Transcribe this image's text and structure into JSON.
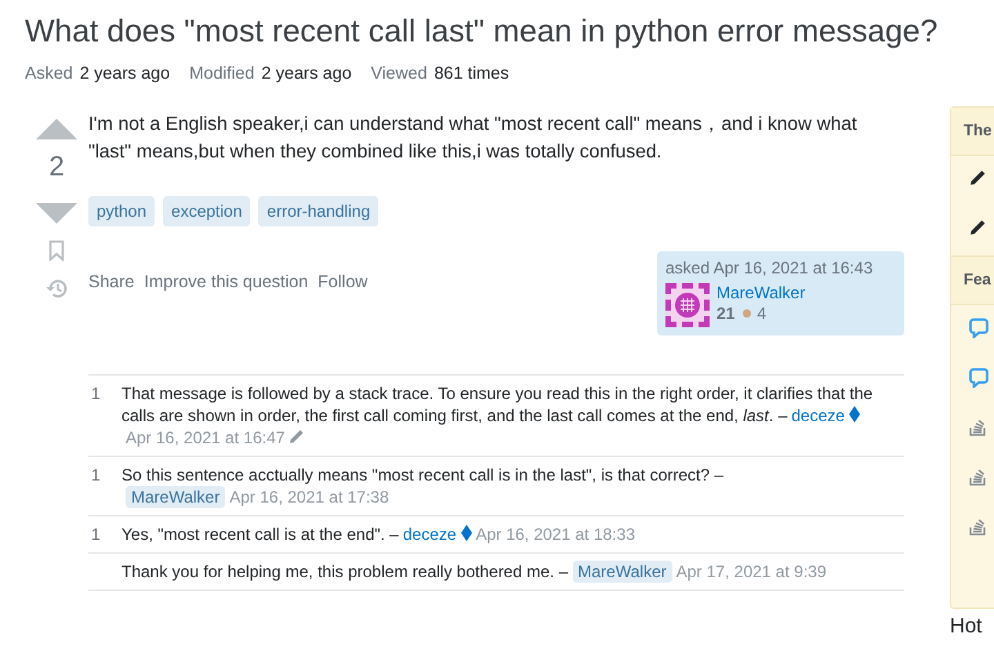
{
  "title": "What does \"most recent call last\" mean in python error message?",
  "meta": [
    {
      "label": "Asked",
      "value": "2 years ago"
    },
    {
      "label": "Modified",
      "value": "2 years ago"
    },
    {
      "label": "Viewed",
      "value": "861 times"
    }
  ],
  "question": {
    "votes": "2",
    "body": "I'm not a English speaker,i can understand what \"most recent call\" means，and i know what \"last\" means,but when they combined like this,i was totally confused.",
    "tags": [
      "python",
      "exception",
      "error-handling"
    ],
    "actions": [
      "Share",
      "Improve this question",
      "Follow"
    ],
    "asked": "asked Apr 16, 2021 at 16:43",
    "user": {
      "name": "MareWalker",
      "reputation": "21",
      "bronze": "4"
    }
  },
  "comments": [
    {
      "score": "1",
      "text": "That message is followed by a stack trace. To ensure you read this in the right order, it clarifies that the calls are shown in order, the first call coming first, and the last call comes at the end, *last*. –",
      "author": "deceze",
      "moderator": true,
      "is_asker": false,
      "date": "Apr 16, 2021 at 16:47",
      "edited": true
    },
    {
      "score": "1",
      "text": "So this sentence acctually means \"most recent call is in the last\", is that correct? –",
      "author": "MareWalker",
      "moderator": false,
      "is_asker": true,
      "date": "Apr 16, 2021 at 17:38",
      "edited": false
    },
    {
      "score": "1",
      "text": "Yes, \"most recent call is at the end\". –",
      "author": "deceze",
      "moderator": true,
      "is_asker": false,
      "date": "Apr 16, 2021 at 18:33",
      "edited": false
    },
    {
      "text": "Thank you for helping me, this problem really bothered me. –",
      "author": "MareWalker",
      "moderator": false,
      "is_asker": true,
      "date": "Apr 17, 2021 at 9:39",
      "edited": false
    }
  ],
  "sidebar": {
    "sections": [
      {
        "title": "The",
        "items": [
          {
            "kind": "pencil"
          },
          {
            "kind": "pencil"
          }
        ]
      },
      {
        "title": "Fea",
        "items": [
          {
            "kind": "chat"
          },
          {
            "kind": "chat"
          },
          {
            "kind": "stack"
          },
          {
            "kind": "stack"
          },
          {
            "kind": "stack"
          }
        ]
      }
    ],
    "next_heading": "Hot"
  }
}
